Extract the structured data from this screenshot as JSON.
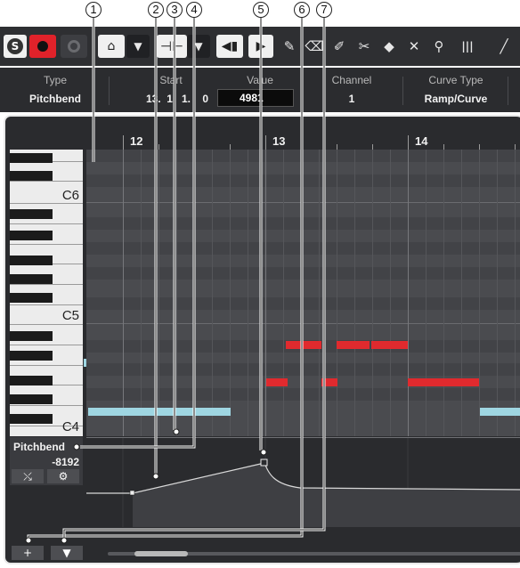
{
  "callouts": [
    "1",
    "2",
    "3",
    "4",
    "5",
    "6",
    "7"
  ],
  "toolbar": {
    "solo_label": "S",
    "record_icon": "record-icon",
    "monitor_icon": "monitor-icon",
    "edit_icon": "edit-in-place-icon",
    "dropdown_glyph": "▼",
    "split_icon": "split-icon",
    "speaker_icon": "speaker-icon",
    "play_icon": "play-icon",
    "tools": [
      "pencil-icon",
      "eraser-icon",
      "knife-icon",
      "scissors-icon",
      "glue-icon",
      "mute-icon",
      "zoom-icon",
      "quantize-icon",
      "line-icon"
    ],
    "tool_glyphs": [
      "✎",
      "⌫",
      "✐",
      "✂",
      "◆",
      "✕",
      "⚲",
      "|||",
      "╱"
    ]
  },
  "infoline": {
    "columns": [
      {
        "label": "Type",
        "value": "Pitchbend"
      },
      {
        "label": "Start",
        "value": "13.  1.  1.    0"
      },
      {
        "label": "Value",
        "value": "4981"
      },
      {
        "label": "Channel",
        "value": "1"
      },
      {
        "label": "Curve Type",
        "value": "Ramp/Curve"
      }
    ]
  },
  "ruler": {
    "bars": [
      "12",
      "13",
      "14"
    ]
  },
  "keyboard": {
    "labels": [
      "C6",
      "C5",
      "C4"
    ]
  },
  "controller": {
    "name": "Pitchbend",
    "value": "-8192",
    "lane_buttons": [
      "⤯",
      "⚙"
    ],
    "bottom_buttons": [
      "+",
      "▼"
    ]
  },
  "colors": {
    "note_blue": "#9fd6e2",
    "note_red": "#e02a2e",
    "background": "#2a2b2e",
    "record_red": "#e0222a"
  }
}
